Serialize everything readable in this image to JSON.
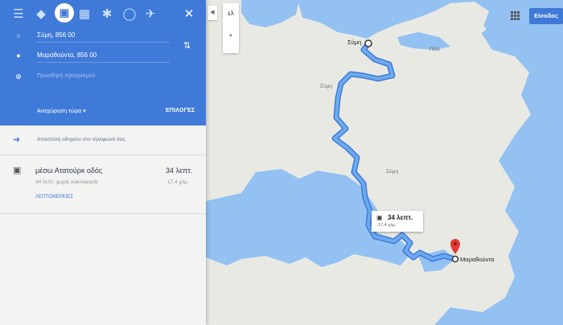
{
  "panel": {
    "from_value": "Σύμη, 856 00",
    "to_value": "Μαραθούντα, 856 00",
    "add_destination": "Προσθήκη προορισμού",
    "departure_label": "Αναχώρηση τώρα",
    "options_label": "ΕΠΙΛΟΓΕΣ",
    "send_to_phone": "Αποστολή οδηγιών στο τηλέφωνό σας",
    "route": {
      "name": "μέσω Ατατούρκ οδός",
      "time": "34 λεπτ.",
      "subtitle": "34 λεπτ. χωρίς κυκλοφορία",
      "distance": "17,4 χλμ.",
      "details": "ΛΕΠΤΟΜΕΡΕΙΕΣ"
    }
  },
  "modes": {
    "selected": "driving",
    "icons": [
      "menu-icon",
      "directions-icon",
      "car-icon",
      "transit-icon",
      "walk-icon",
      "bike-icon",
      "flight-icon",
      "close-icon"
    ]
  },
  "map": {
    "language": "ελ",
    "signin_label": "Είσοδος",
    "origin_label": "Σύμη",
    "destination_label": "Μαραθούντα",
    "labels": {
      "pedi": "Πέδι",
      "symi_center": "Σύμη",
      "small_town": "Σύμη"
    },
    "callout": {
      "time": "34 λεπτ.",
      "distance": "17,4 χλμ."
    },
    "colors": {
      "water": "#93c1f2",
      "land": "#e9e9e4",
      "route": "#5b9ce8",
      "route_outline": "#3f7ad8",
      "marker": "#e53935"
    }
  }
}
